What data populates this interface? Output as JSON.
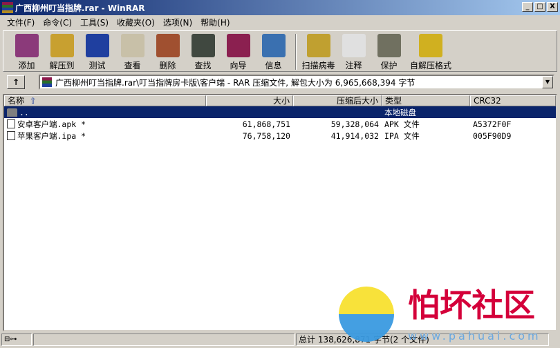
{
  "window": {
    "title": "广西柳州叮当指牌.rar - WinRAR",
    "minimize": "_",
    "maximize": "□",
    "close": "X"
  },
  "menu": [
    "文件(F)",
    "命令(C)",
    "工具(S)",
    "收藏夹(O)",
    "选项(N)",
    "帮助(H)"
  ],
  "toolbar": [
    {
      "label": "添加",
      "icon": "add-archive-icon",
      "color": "#8b3a7a"
    },
    {
      "label": "解压到",
      "icon": "extract-to-icon",
      "color": "#c8a030"
    },
    {
      "label": "测试",
      "icon": "test-icon",
      "color": "#1f3f9f"
    },
    {
      "label": "查看",
      "icon": "view-icon",
      "color": "#c8c0a8"
    },
    {
      "label": "删除",
      "icon": "delete-icon",
      "color": "#a05030"
    },
    {
      "label": "查找",
      "icon": "find-icon",
      "color": "#404840"
    },
    {
      "label": "向导",
      "icon": "wizard-icon",
      "color": "#8b2050"
    },
    {
      "label": "信息",
      "icon": "info-icon",
      "color": "#3a70b0"
    },
    {
      "label": "扫描病毒",
      "icon": "virus-scan-icon",
      "color": "#c0a030"
    },
    {
      "label": "注释",
      "icon": "comment-icon",
      "color": "#e0e0e0"
    },
    {
      "label": "保护",
      "icon": "protect-icon",
      "color": "#707060"
    },
    {
      "label": "自解压格式",
      "icon": "sfx-icon",
      "color": "#d0b020"
    }
  ],
  "address": {
    "up": "↑",
    "path": "广西柳州叮当指牌.rar\\叮当指牌房卡版\\客户端 - RAR 压缩文件, 解包大小为 6,965,668,394 字节",
    "dropdown": "▼"
  },
  "columns": {
    "name": "名称",
    "sort": "⇧",
    "size": "大小",
    "packed": "压缩后大小",
    "type": "类型",
    "crc": "CRC32"
  },
  "rows": [
    {
      "name": "..",
      "size": "",
      "packed": "",
      "type": "本地磁盘",
      "crc": "",
      "kind": "folder",
      "selected": true
    },
    {
      "name": "安卓客户端.apk *",
      "size": "61,868,751",
      "packed": "59,328,064",
      "type": "APK 文件",
      "crc": "A5372F0F",
      "kind": "file"
    },
    {
      "name": "苹果客户端.ipa *",
      "size": "76,758,120",
      "packed": "41,914,032",
      "type": "IPA 文件",
      "crc": "005F90D9",
      "kind": "file"
    }
  ],
  "status": {
    "left": "⊟⊶",
    "total": "总计 138,626,871 字节(2 个文件)"
  },
  "watermark": {
    "text": "怕坏社区",
    "url": "www.pahuai.com"
  }
}
